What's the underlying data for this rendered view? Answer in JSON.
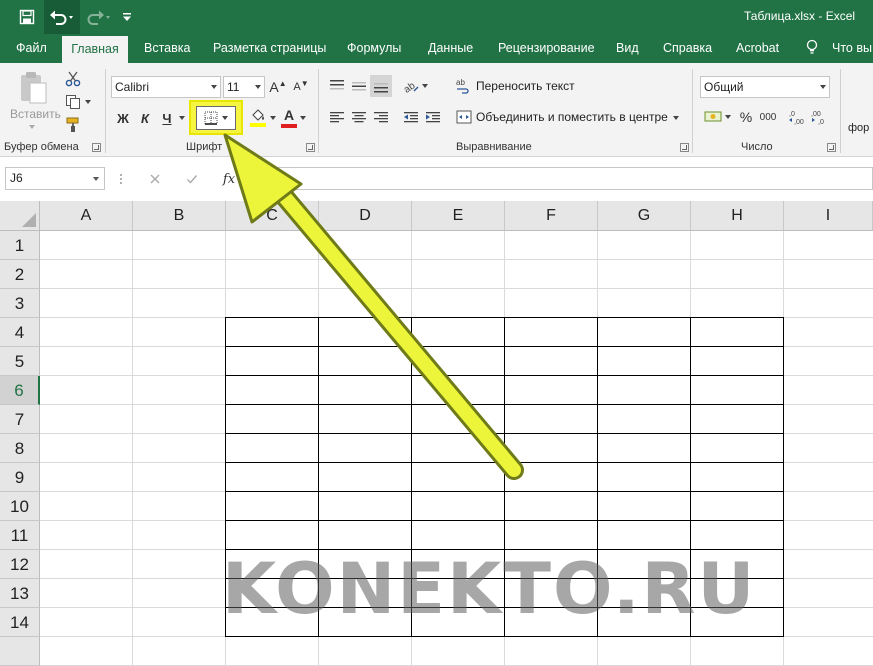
{
  "titlebar": {
    "title": "Таблица.xlsx  -  Excel",
    "icons": [
      "save-icon",
      "undo-icon",
      "redo-icon",
      "customize-quick-access-icon"
    ]
  },
  "ribbon_tabs": [
    "Файл",
    "Главная",
    "Вставка",
    "Разметка страницы",
    "Формулы",
    "Данные",
    "Рецензирование",
    "Вид",
    "Справка",
    "Acrobat",
    "Что вы"
  ],
  "active_tab": "Главная",
  "clipboard": {
    "paste_label": "Вставить",
    "group_label": "Буфер обмена"
  },
  "font": {
    "name": "Calibri",
    "size": "11",
    "grow": "A",
    "shrink": "A",
    "bold": "Ж",
    "italic": "К",
    "underline": "Ч",
    "font_color_letter": "A",
    "group_label": "Шрифт"
  },
  "alignment": {
    "wrap_text": "Переносить текст",
    "merge_center": "Объединить и поместить в центре",
    "group_label": "Выравнивание"
  },
  "number": {
    "format": "Общий",
    "percent": "%",
    "thousands": "000",
    "group_label": "Число"
  },
  "styles_partial": "фор",
  "formula_bar": {
    "name_box": "J6",
    "fx": "fx",
    "formula": ""
  },
  "columns": [
    "A",
    "B",
    "C",
    "D",
    "E",
    "F",
    "G",
    "H",
    "I"
  ],
  "rows": [
    "1",
    "2",
    "3",
    "4",
    "5",
    "6",
    "7",
    "8",
    "9",
    "10",
    "11",
    "12",
    "13",
    "14"
  ],
  "selected_row": "6",
  "table_range": "C4:H14",
  "watermark": "KONEKTO.RU",
  "colors": {
    "excel_green": "#217346",
    "highlight": "#f5f542",
    "arrow_yellow": "#ecf53a",
    "font_color_red": "#e02020",
    "fill_yellow": "#ffff00"
  }
}
